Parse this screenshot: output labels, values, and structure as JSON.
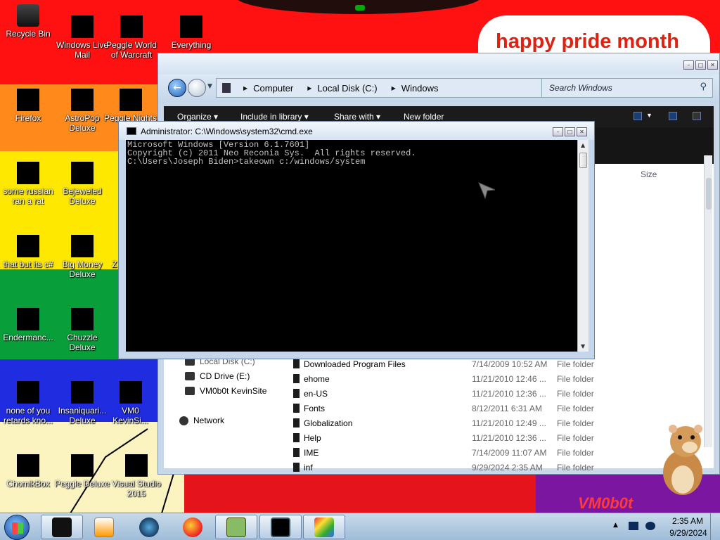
{
  "desktop": {
    "banner": "happy pride month",
    "brand": "VM0b0t",
    "icons": [
      {
        "label": "Recycle Bin"
      },
      {
        "label": "Windows Live\nMail"
      },
      {
        "label": "Peggle World\nof Warcraft"
      },
      {
        "label": "Everything"
      },
      {
        "label": "Firefox"
      },
      {
        "label": "AstroPop\nDeluxe"
      },
      {
        "label": "Peggle Nights"
      },
      {
        "label": "some russian\nran a rat"
      },
      {
        "label": "Bejeweled\nDeluxe"
      },
      {
        "label": "that but its c#"
      },
      {
        "label": "Big Money\nDeluxe"
      },
      {
        "label": "Zuma"
      },
      {
        "label": "Endermanc..."
      },
      {
        "label": "Chuzzle\nDeluxe"
      },
      {
        "label": "none of you\nretards kno..."
      },
      {
        "label": "Insaniquari...\nDeluxe"
      },
      {
        "label": "VM0\nKevinSi..."
      },
      {
        "label": "ChomikBox"
      },
      {
        "label": "Peggle Deluxe"
      },
      {
        "label": "Visual Studio\n2015"
      }
    ]
  },
  "explorer": {
    "breadcrumbs": [
      "Computer",
      "Local Disk (C:)",
      "Windows"
    ],
    "search_placeholder": "Search Windows",
    "toolbar": {
      "organize": "Organize ▾",
      "include": "Include in library ▾",
      "share": "Share with ▾",
      "new_folder": "New folder"
    },
    "size_header": "Size",
    "tree": [
      {
        "label": "Local Disk (C:)"
      },
      {
        "label": "CD Drive (E:)"
      },
      {
        "label": "VM0b0t KevinSite"
      },
      {
        "label": "Network"
      }
    ],
    "files": [
      {
        "name": "Downloaded Program Files",
        "date": "7/14/2009 10:52 AM",
        "type": "File folder"
      },
      {
        "name": "ehome",
        "date": "11/21/2010 12:46 ...",
        "type": "File folder"
      },
      {
        "name": "en-US",
        "date": "11/21/2010 12:36 ...",
        "type": "File folder"
      },
      {
        "name": "Fonts",
        "date": "8/12/2011 6:31 AM",
        "type": "File folder"
      },
      {
        "name": "Globalization",
        "date": "11/21/2010 12:49 ...",
        "type": "File folder"
      },
      {
        "name": "Help",
        "date": "11/21/2010 12:36 ...",
        "type": "File folder"
      },
      {
        "name": "IME",
        "date": "7/14/2009 11:07 AM",
        "type": "File folder"
      },
      {
        "name": "inf",
        "date": "9/29/2024 2:35 AM",
        "type": "File folder"
      }
    ]
  },
  "cmd": {
    "title": "Administrator: C:\\Windows\\system32\\cmd.exe",
    "lines": [
      "Microsoft Windows [Version 6.1.7601]",
      "Copyright (c) 2011 Neo Reconia Sys.  All rights reserved.",
      "",
      "C:\\Users\\Joseph Biden>takeown c:/windows/system"
    ]
  },
  "taskbar": {
    "time": "2:35 AM",
    "date": "9/29/2024"
  }
}
